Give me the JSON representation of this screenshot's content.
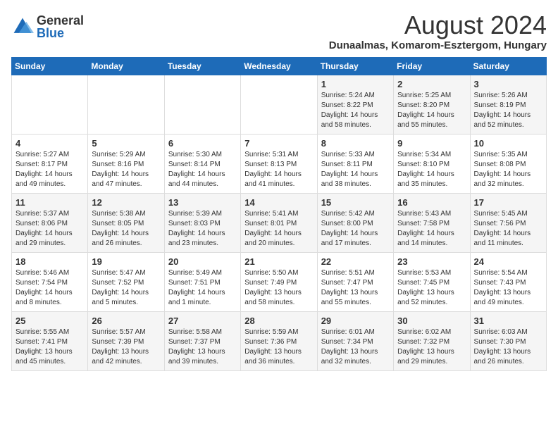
{
  "header": {
    "logo_general": "General",
    "logo_blue": "Blue",
    "month_title": "August 2024",
    "location": "Dunaalmas, Komarom-Esztergom, Hungary"
  },
  "weekdays": [
    "Sunday",
    "Monday",
    "Tuesday",
    "Wednesday",
    "Thursday",
    "Friday",
    "Saturday"
  ],
  "weeks": [
    [
      {
        "day": "",
        "info": ""
      },
      {
        "day": "",
        "info": ""
      },
      {
        "day": "",
        "info": ""
      },
      {
        "day": "",
        "info": ""
      },
      {
        "day": "1",
        "info": "Sunrise: 5:24 AM\nSunset: 8:22 PM\nDaylight: 14 hours\nand 58 minutes."
      },
      {
        "day": "2",
        "info": "Sunrise: 5:25 AM\nSunset: 8:20 PM\nDaylight: 14 hours\nand 55 minutes."
      },
      {
        "day": "3",
        "info": "Sunrise: 5:26 AM\nSunset: 8:19 PM\nDaylight: 14 hours\nand 52 minutes."
      }
    ],
    [
      {
        "day": "4",
        "info": "Sunrise: 5:27 AM\nSunset: 8:17 PM\nDaylight: 14 hours\nand 49 minutes."
      },
      {
        "day": "5",
        "info": "Sunrise: 5:29 AM\nSunset: 8:16 PM\nDaylight: 14 hours\nand 47 minutes."
      },
      {
        "day": "6",
        "info": "Sunrise: 5:30 AM\nSunset: 8:14 PM\nDaylight: 14 hours\nand 44 minutes."
      },
      {
        "day": "7",
        "info": "Sunrise: 5:31 AM\nSunset: 8:13 PM\nDaylight: 14 hours\nand 41 minutes."
      },
      {
        "day": "8",
        "info": "Sunrise: 5:33 AM\nSunset: 8:11 PM\nDaylight: 14 hours\nand 38 minutes."
      },
      {
        "day": "9",
        "info": "Sunrise: 5:34 AM\nSunset: 8:10 PM\nDaylight: 14 hours\nand 35 minutes."
      },
      {
        "day": "10",
        "info": "Sunrise: 5:35 AM\nSunset: 8:08 PM\nDaylight: 14 hours\nand 32 minutes."
      }
    ],
    [
      {
        "day": "11",
        "info": "Sunrise: 5:37 AM\nSunset: 8:06 PM\nDaylight: 14 hours\nand 29 minutes."
      },
      {
        "day": "12",
        "info": "Sunrise: 5:38 AM\nSunset: 8:05 PM\nDaylight: 14 hours\nand 26 minutes."
      },
      {
        "day": "13",
        "info": "Sunrise: 5:39 AM\nSunset: 8:03 PM\nDaylight: 14 hours\nand 23 minutes."
      },
      {
        "day": "14",
        "info": "Sunrise: 5:41 AM\nSunset: 8:01 PM\nDaylight: 14 hours\nand 20 minutes."
      },
      {
        "day": "15",
        "info": "Sunrise: 5:42 AM\nSunset: 8:00 PM\nDaylight: 14 hours\nand 17 minutes."
      },
      {
        "day": "16",
        "info": "Sunrise: 5:43 AM\nSunset: 7:58 PM\nDaylight: 14 hours\nand 14 minutes."
      },
      {
        "day": "17",
        "info": "Sunrise: 5:45 AM\nSunset: 7:56 PM\nDaylight: 14 hours\nand 11 minutes."
      }
    ],
    [
      {
        "day": "18",
        "info": "Sunrise: 5:46 AM\nSunset: 7:54 PM\nDaylight: 14 hours\nand 8 minutes."
      },
      {
        "day": "19",
        "info": "Sunrise: 5:47 AM\nSunset: 7:52 PM\nDaylight: 14 hours\nand 5 minutes."
      },
      {
        "day": "20",
        "info": "Sunrise: 5:49 AM\nSunset: 7:51 PM\nDaylight: 14 hours\nand 1 minute."
      },
      {
        "day": "21",
        "info": "Sunrise: 5:50 AM\nSunset: 7:49 PM\nDaylight: 13 hours\nand 58 minutes."
      },
      {
        "day": "22",
        "info": "Sunrise: 5:51 AM\nSunset: 7:47 PM\nDaylight: 13 hours\nand 55 minutes."
      },
      {
        "day": "23",
        "info": "Sunrise: 5:53 AM\nSunset: 7:45 PM\nDaylight: 13 hours\nand 52 minutes."
      },
      {
        "day": "24",
        "info": "Sunrise: 5:54 AM\nSunset: 7:43 PM\nDaylight: 13 hours\nand 49 minutes."
      }
    ],
    [
      {
        "day": "25",
        "info": "Sunrise: 5:55 AM\nSunset: 7:41 PM\nDaylight: 13 hours\nand 45 minutes."
      },
      {
        "day": "26",
        "info": "Sunrise: 5:57 AM\nSunset: 7:39 PM\nDaylight: 13 hours\nand 42 minutes."
      },
      {
        "day": "27",
        "info": "Sunrise: 5:58 AM\nSunset: 7:37 PM\nDaylight: 13 hours\nand 39 minutes."
      },
      {
        "day": "28",
        "info": "Sunrise: 5:59 AM\nSunset: 7:36 PM\nDaylight: 13 hours\nand 36 minutes."
      },
      {
        "day": "29",
        "info": "Sunrise: 6:01 AM\nSunset: 7:34 PM\nDaylight: 13 hours\nand 32 minutes."
      },
      {
        "day": "30",
        "info": "Sunrise: 6:02 AM\nSunset: 7:32 PM\nDaylight: 13 hours\nand 29 minutes."
      },
      {
        "day": "31",
        "info": "Sunrise: 6:03 AM\nSunset: 7:30 PM\nDaylight: 13 hours\nand 26 minutes."
      }
    ]
  ]
}
